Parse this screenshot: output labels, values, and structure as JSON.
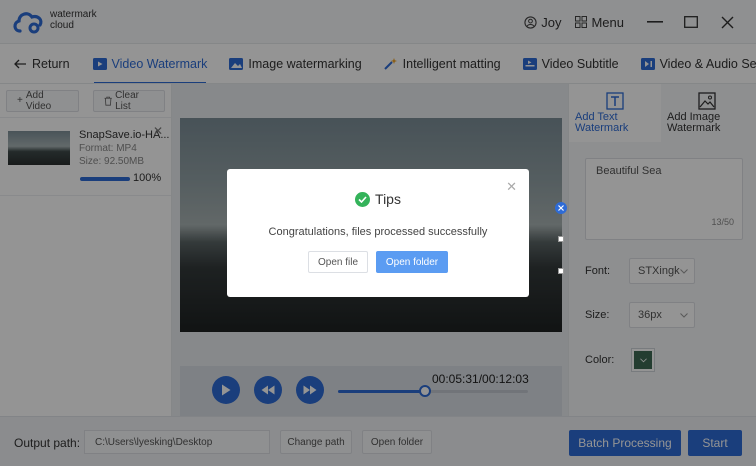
{
  "app": {
    "logo_line1": "watermark",
    "logo_line2": "cloud"
  },
  "titlebar": {
    "user": "Joy",
    "menu_label": "Menu"
  },
  "nav": {
    "return_label": "Return",
    "tabs": [
      {
        "label": "Video Watermark",
        "icon": "video-icon"
      },
      {
        "label": "Image watermarking",
        "icon": "image-icon"
      },
      {
        "label": "Intelligent matting",
        "icon": "magic-wand-icon"
      },
      {
        "label": "Video Subtitle",
        "icon": "subtitle-icon"
      },
      {
        "label": "Video & Audio Sepa",
        "icon": "audio-split-icon"
      }
    ]
  },
  "file_list": {
    "add_label": "Add Video",
    "clear_label": "Clear List",
    "items": [
      {
        "name": "SnapSave.io-HA...",
        "format": "Format:  MP4",
        "size": "Size:  92.50MB",
        "progress_label": "100%",
        "progress": 1.0
      }
    ]
  },
  "player": {
    "time": "00:05:31/00:12:03",
    "progress": 0.46
  },
  "watermark": {
    "tab_text": "Add Text Watermark",
    "tab_image": "Add Image Watermark",
    "text": "Beautiful Sea",
    "char_count": "13/50",
    "font_label": "Font:",
    "font_value": "STXingk",
    "size_label": "Size:",
    "size_value": "36px",
    "color_label": "Color:",
    "color_value": "#3e6a55"
  },
  "footer": {
    "output_label": "Output path:",
    "output_path": "C:\\Users\\lyesking\\Desktop",
    "change_path": "Change path",
    "open_folder": "Open folder",
    "batch": "Batch Processing",
    "start": "Start"
  },
  "modal": {
    "title": "Tips",
    "message": "Congratulations, files processed successfully",
    "open_file": "Open file",
    "open_folder": "Open folder"
  }
}
